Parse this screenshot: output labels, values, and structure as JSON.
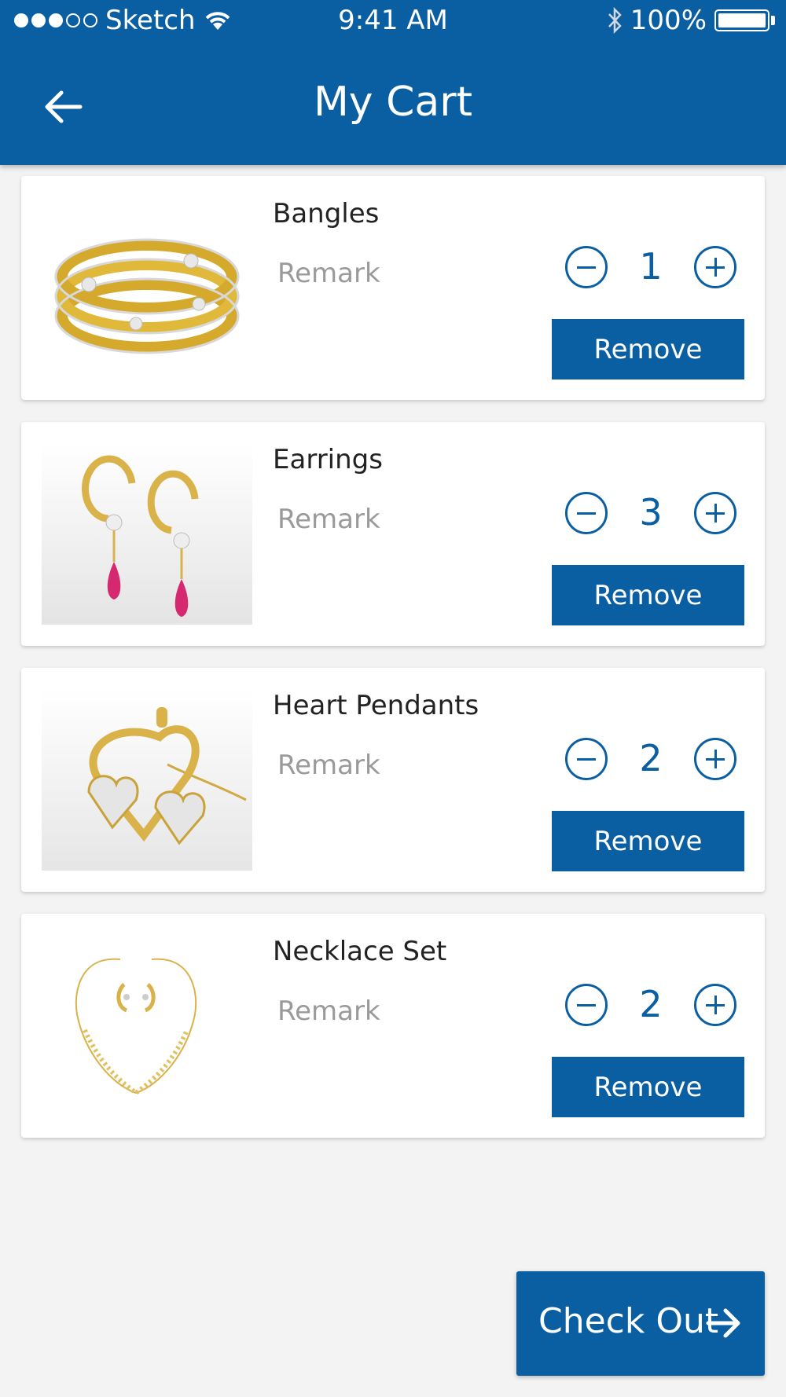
{
  "status_bar": {
    "carrier": "Sketch",
    "time": "9:41 AM",
    "battery": "100%",
    "battery_level": 1.0
  },
  "header": {
    "title": "My Cart",
    "back_icon": "arrow-left-icon"
  },
  "cart": {
    "items": [
      {
        "name": "Bangles",
        "remark_placeholder": "Remark",
        "quantity": "1",
        "remove_label": "Remove",
        "image": "bangles-image"
      },
      {
        "name": "Earrings",
        "remark_placeholder": "Remark",
        "quantity": "3",
        "remove_label": "Remove",
        "image": "earrings-image"
      },
      {
        "name": "Heart Pendants",
        "remark_placeholder": "Remark",
        "quantity": "2",
        "remove_label": "Remove",
        "image": "heart-pendant-image"
      },
      {
        "name": "Necklace Set",
        "remark_placeholder": "Remark",
        "quantity": "2",
        "remove_label": "Remove",
        "image": "necklace-image"
      }
    ]
  },
  "checkout": {
    "label": "Check Out",
    "icon": "arrow-right-icon"
  },
  "colors": {
    "brand": "#0a5ea2",
    "background": "#f3f3f3",
    "remark_text": "#9a9a9a"
  }
}
